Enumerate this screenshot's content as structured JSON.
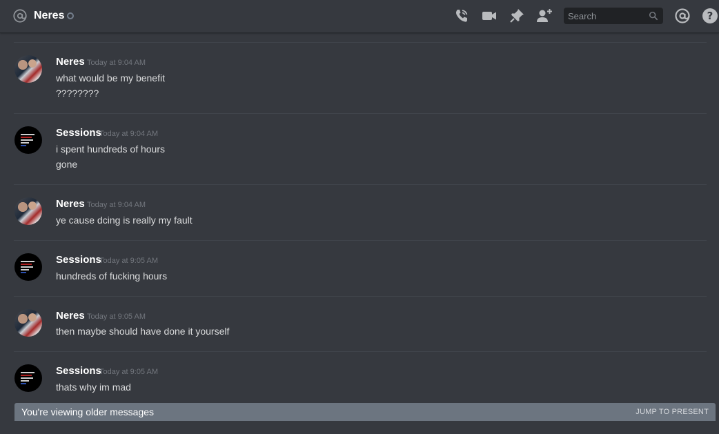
{
  "header": {
    "channel_name": "Neres",
    "status": "offline",
    "search_placeholder": "Search",
    "icons": [
      "at-icon",
      "call-icon",
      "video-icon",
      "pin-icon",
      "add-friend-icon",
      "search-icon",
      "mentions-icon",
      "help-icon"
    ]
  },
  "messages": [
    {
      "author": "Neres",
      "timestamp": "Today at 9:04 AM",
      "avatar": "neres",
      "lines": [
        "what would be my benefit",
        "????????"
      ]
    },
    {
      "author": "Sessions",
      "timestamp": "Today at 9:04 AM",
      "avatar": "sessions",
      "lines": [
        "i spent hundreds of hours",
        "gone"
      ]
    },
    {
      "author": "Neres",
      "timestamp": "Today at 9:04 AM",
      "avatar": "neres",
      "lines": [
        "ye cause dcing is really my fault"
      ]
    },
    {
      "author": "Sessions",
      "timestamp": "Today at 9:05 AM",
      "avatar": "sessions",
      "lines": [
        "hundreds of fucking hours"
      ]
    },
    {
      "author": "Neres",
      "timestamp": "Today at 9:05 AM",
      "avatar": "neres",
      "lines": [
        "then maybe should have done it yourself"
      ]
    },
    {
      "author": "Sessions",
      "timestamp": "Today at 9:05 AM",
      "avatar": "sessions",
      "lines": [
        "thats why im mad"
      ]
    }
  ],
  "footer": {
    "older_text": "You're viewing older messages",
    "jump_label": "JUMP TO PRESENT"
  },
  "colors": {
    "background": "#36393f",
    "search_bg": "#202225",
    "older_bar": "#6c7580",
    "timestamp": "#72767d"
  }
}
